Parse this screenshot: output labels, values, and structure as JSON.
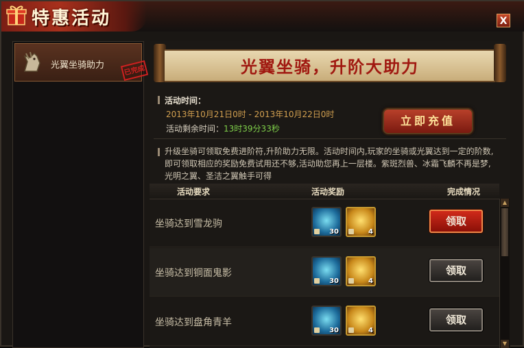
{
  "window": {
    "title": "特惠活动",
    "close_label": "X"
  },
  "sidebar": {
    "items": [
      {
        "label": "光翼坐骑助力",
        "stamp": "已完成",
        "icon": "horse-head-icon"
      }
    ]
  },
  "banner": {
    "title": "光翼坐骑，升阶大助力"
  },
  "event": {
    "time_label": "活动时间：",
    "date_range": "2013年10月21日0时 - 2013年10月22日0时",
    "remaining_label": "活动剩余时间：",
    "remaining_value": "13时39分33秒",
    "recharge_button": "立即充值",
    "description": "升级坐骑可领取免费进阶符,升阶助力无限。活动时间内,玩家的坐骑或光翼达到一定的阶数,即可领取相应的奖励免费试用还不够,活动助您再上一层楼。紫斑烈兽、冰霜飞麟不再是梦,光明之翼、圣洁之翼触手可得"
  },
  "table": {
    "headers": [
      "活动要求",
      "活动奖励",
      "完成情况"
    ],
    "rows": [
      {
        "requirement": "坐骑达到雪龙驹",
        "reward1_count": "30",
        "reward2_count": "4",
        "claim": "领取",
        "active": true
      },
      {
        "requirement": "坐骑达到铜面鬼影",
        "reward1_count": "30",
        "reward2_count": "4",
        "claim": "领取",
        "active": false
      },
      {
        "requirement": "坐骑达到盘角青羊",
        "reward1_count": "30",
        "reward2_count": "4",
        "claim": "领取",
        "active": false
      }
    ]
  },
  "colors": {
    "accent_red": "#a01810",
    "remaining_green": "#7fd04a",
    "date_orange": "#d2a050"
  }
}
